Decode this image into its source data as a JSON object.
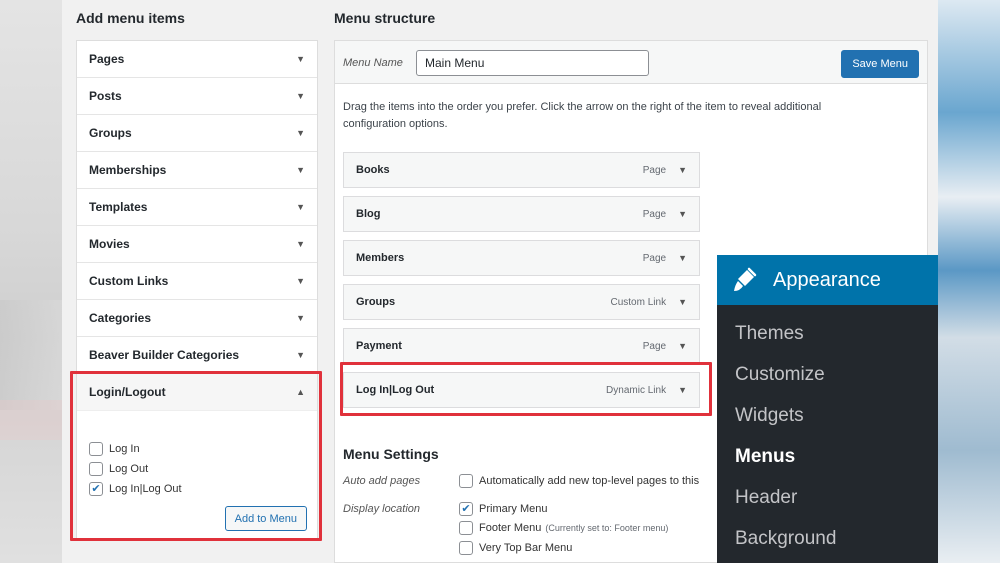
{
  "left_column": {
    "title": "Add menu items",
    "sections": [
      {
        "label": "Pages"
      },
      {
        "label": "Posts"
      },
      {
        "label": "Groups"
      },
      {
        "label": "Memberships"
      },
      {
        "label": "Templates"
      },
      {
        "label": "Movies"
      },
      {
        "label": "Custom Links"
      },
      {
        "label": "Categories"
      },
      {
        "label": "Beaver Builder Categories"
      }
    ],
    "open_section": {
      "label": "Login/Logout",
      "options": [
        {
          "label": "Log In",
          "checked": false
        },
        {
          "label": "Log Out",
          "checked": false
        },
        {
          "label": "Log In|Log Out",
          "checked": true
        }
      ],
      "button_label": "Add to Menu"
    }
  },
  "right_column": {
    "title": "Menu structure",
    "menu_name_label": "Menu Name",
    "menu_name_value": "Main Menu",
    "save_button_label": "Save Menu",
    "instructions": "Drag the items into the order you prefer. Click the arrow on the right of the item to reveal additional configuration options.",
    "menu_items": [
      {
        "title": "Books",
        "type": "Page"
      },
      {
        "title": "Blog",
        "type": "Page"
      },
      {
        "title": "Members",
        "type": "Page"
      },
      {
        "title": "Groups",
        "type": "Custom Link"
      },
      {
        "title": "Payment",
        "type": "Page"
      },
      {
        "title": "Log In|Log Out",
        "type": "Dynamic Link"
      }
    ],
    "settings": {
      "title": "Menu Settings",
      "auto_add_label": "Auto add pages",
      "auto_add_option": "Automatically add new top-level pages to this",
      "display_location_label": "Display location",
      "locations": [
        {
          "label": "Primary Menu",
          "checked": true,
          "note": ""
        },
        {
          "label": "Footer Menu",
          "checked": false,
          "note": "(Currently set to: Footer menu)"
        },
        {
          "label": "Very Top Bar Menu",
          "checked": false,
          "note": ""
        }
      ]
    }
  },
  "appearance_menu": {
    "title": "Appearance",
    "items": [
      {
        "label": "Themes"
      },
      {
        "label": "Customize"
      },
      {
        "label": "Widgets"
      },
      {
        "label": "Menus"
      },
      {
        "label": "Header"
      },
      {
        "label": "Background"
      }
    ],
    "current": "Menus"
  },
  "colors": {
    "highlight_red": "#e0313b",
    "primary_blue": "#2271b1",
    "admin_blue": "#0073aa",
    "admin_dark": "#23282d"
  }
}
